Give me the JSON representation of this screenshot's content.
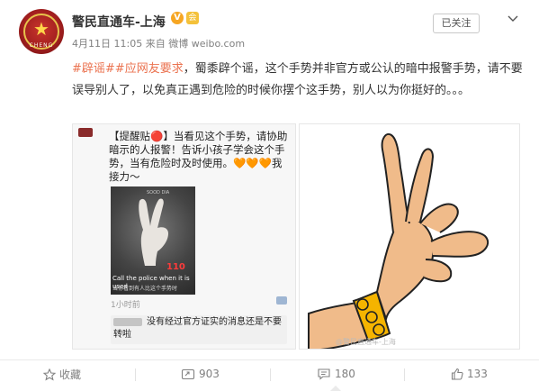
{
  "header": {
    "account_name": "警民直通车-上海",
    "verified_badge": "V",
    "level_badge": "会",
    "timestamp": "4月11日 11:05",
    "source_prefix": "来自",
    "source": "微博 weibo.com",
    "follow_label": "已关注",
    "avatar_text": "CHENG",
    "icons": {
      "avatar": "police-emblem-avatar",
      "menu": "chevron-down-icon"
    }
  },
  "post": {
    "tag1": "#辟谣#",
    "tag2": "#应网友要求",
    "text": "，蜀黍辟个谣，这个手势并非官方或公认的暗中报警手势，请不要误导别人了，以免真正遇到危险的时候你摆个这手势，别人以为你挺好的。。。"
  },
  "image1": {
    "post_text": "【提醒贴🔴】当看见这个手势，请协助暗示的人报警！告诉小孩子学会这个手势，当有危险时及时使用。🧡🧡🧡我接力～",
    "photo_small_text": "SOOD DIA",
    "photo_number": "110",
    "photo_caption": "Call the police when it is used",
    "photo_caption2": "当你看到有人比这个手势时",
    "time_ago": "1小时前",
    "reply_text": "没有经过官方证实的消息还是不要转啦"
  },
  "image2": {
    "watermark": "@警民直通车-上海",
    "watermark2": "weibo.com/shanghaipolice"
  },
  "actions": [
    {
      "icon": "star-icon",
      "label": "收藏"
    },
    {
      "icon": "share-icon",
      "label": "903"
    },
    {
      "icon": "comment-icon",
      "label": "180"
    },
    {
      "icon": "like-icon",
      "label": "133"
    }
  ],
  "colors": {
    "tag": "#eb7350",
    "link": "#eb7350",
    "badge": "#f6a623"
  }
}
